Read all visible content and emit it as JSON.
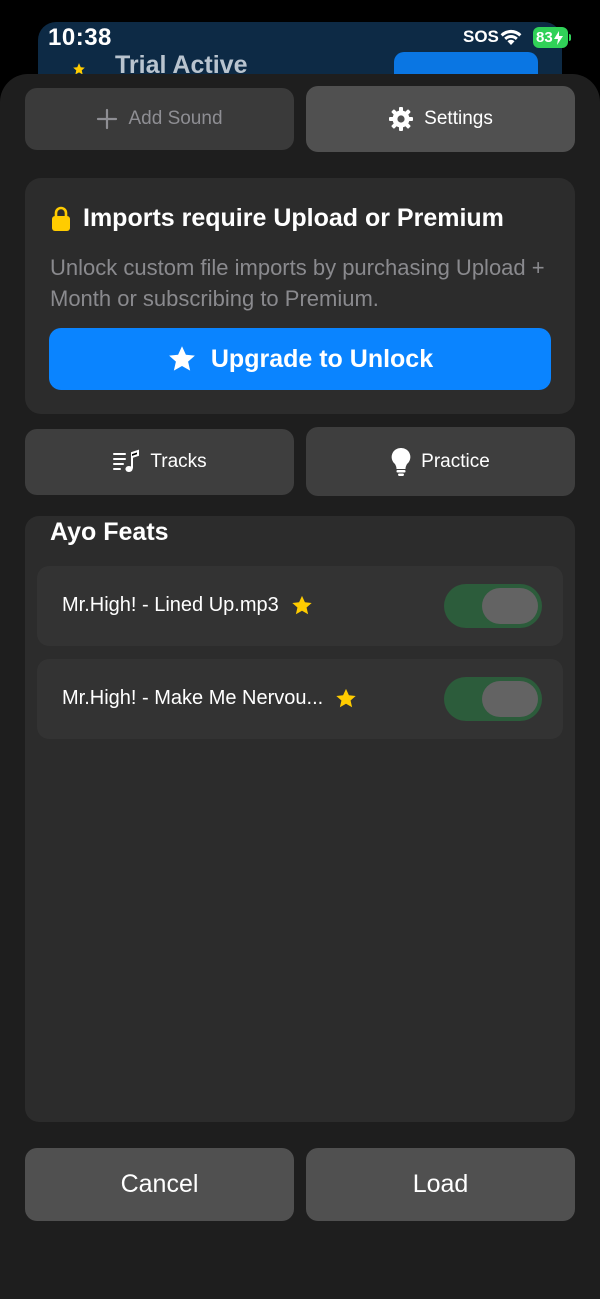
{
  "status_bar": {
    "time": "10:38",
    "sos": "SOS",
    "battery": "83"
  },
  "background_screen": {
    "title": "Trial Active"
  },
  "top_actions": {
    "add_sound_label": "Add Sound",
    "settings_label": "Settings"
  },
  "imports_notice": {
    "title": "Imports require Upload or Premium",
    "description": "Unlock custom file imports by purchasing Upload + Month or subscribing to Premium.",
    "upgrade_label": "Upgrade to Unlock"
  },
  "mode_tabs": {
    "tracks_label": "Tracks",
    "practice_label": "Practice"
  },
  "playlist": {
    "title": "Ayo Feats",
    "items": [
      {
        "name": "Mr.High! - Lined Up.mp3",
        "starred": true,
        "enabled": true
      },
      {
        "name": "Mr.High! - Make Me Nervou...",
        "starred": true,
        "enabled": true
      }
    ]
  },
  "footer": {
    "cancel_label": "Cancel",
    "load_label": "Load"
  },
  "colors": {
    "accent": "#0a84ff",
    "star": "#ffcc00",
    "toggle_on": "#2c5c3b",
    "battery": "#30d158"
  }
}
